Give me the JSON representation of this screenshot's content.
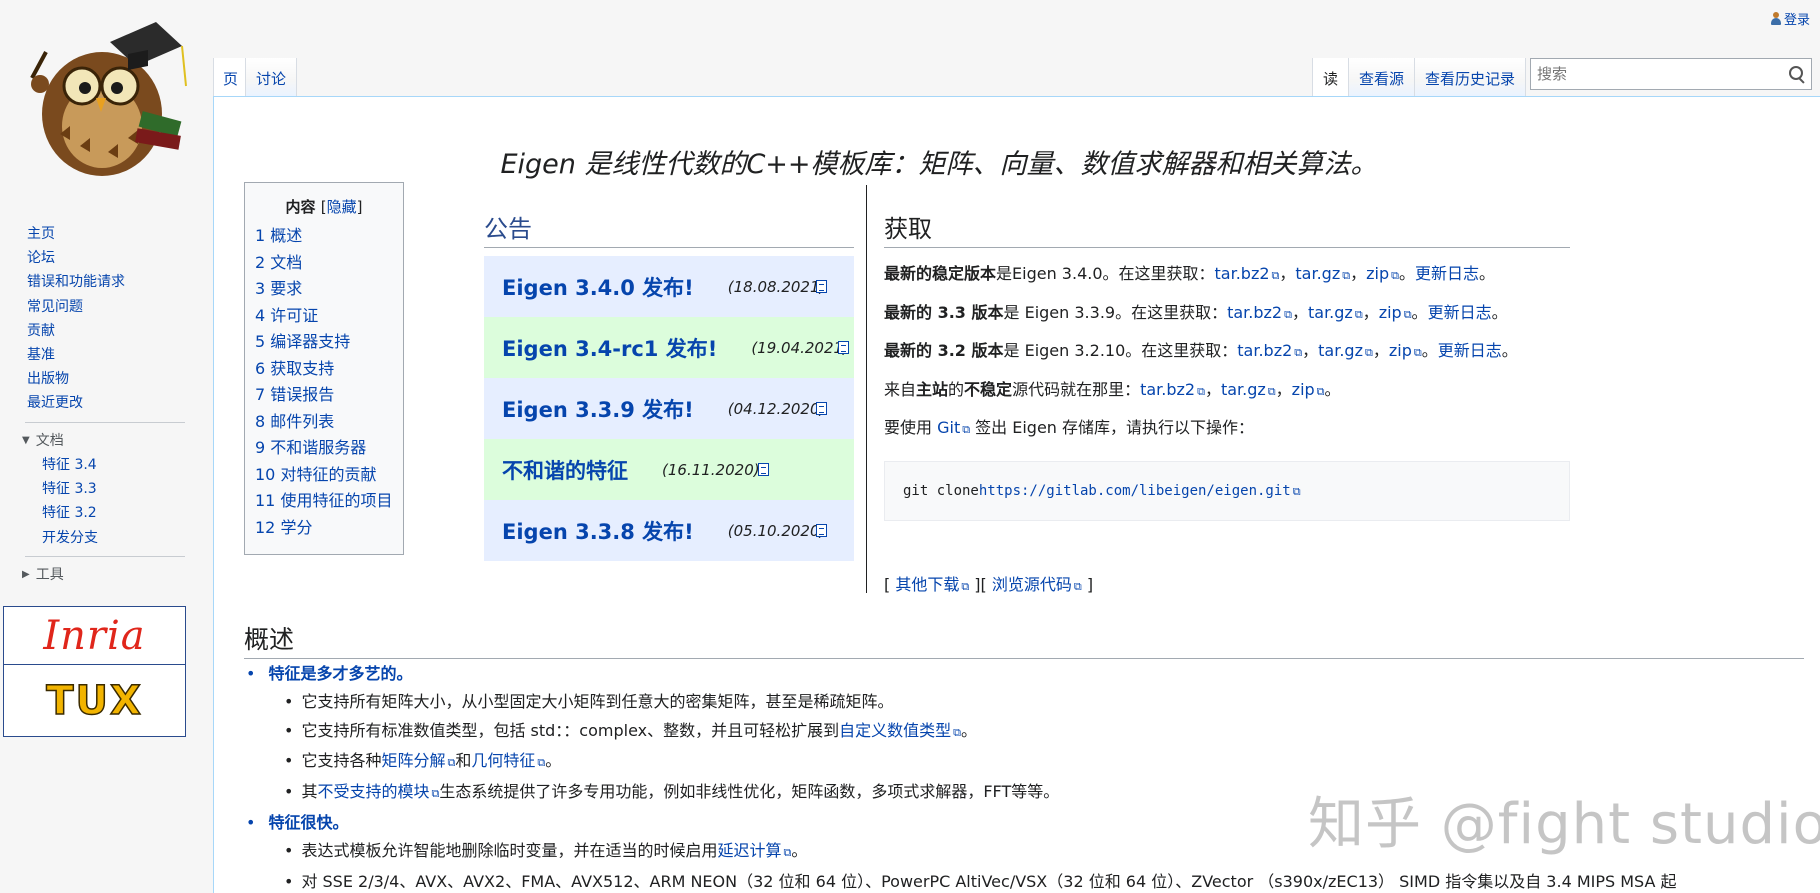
{
  "header": {
    "login": "登录",
    "tabs_left": [
      "页",
      "讨论"
    ],
    "tabs_right": [
      "读",
      "查看源",
      "查看历史记录"
    ],
    "search_placeholder": "搜索"
  },
  "sidebar": {
    "nav": [
      "主页",
      "论坛",
      "错误和功能请求",
      "常见问题",
      "贡献",
      "基准",
      "出版物",
      "最近更改"
    ],
    "docs_heading": "文档",
    "docs_items": [
      "特征 3.4",
      "特征 3.3",
      "特征 3.2",
      "开发分支"
    ],
    "tools_heading": "工具",
    "partner_inria": "Inria",
    "partner_tux": "TUX"
  },
  "tagline": "Eigen 是线性代数的C++模板库：矩阵、向量、数值求解器和相关算法。",
  "toc": {
    "title": "内容",
    "hide_open": "[",
    "hide": "隐藏",
    "hide_close": "]",
    "items": [
      "1 概述",
      "2 文档",
      "3 要求",
      "4 许可证",
      "5 编译器支持",
      "6 获取支持",
      "7 错误报告",
      "8 邮件列表",
      "9 不和谐服务器",
      "10 对特征的贡献",
      "11 使用特征的项目",
      "12 学分"
    ]
  },
  "news": {
    "heading": "公告",
    "items": [
      {
        "title": "Eigen 3.4.0 发布!",
        "date": "(18.08.2021)"
      },
      {
        "title": "Eigen 3.4-rc1 发布!",
        "date": "(19.04.2021)"
      },
      {
        "title": "Eigen 3.3.9 发布!",
        "date": "(04.12.2020)"
      },
      {
        "title": "不和谐的特征",
        "date": "(16.11.2020)"
      },
      {
        "title": "Eigen 3.3.8 发布!",
        "date": "(05.10.2020)"
      }
    ]
  },
  "get": {
    "heading": "获取",
    "line1_bold": "最新的稳定版本",
    "line1_text": "是Eigen 3.4.0。在这里获取：",
    "line2_bold": "最新的 3.3 版本",
    "line2_text": "是 Eigen 3.3.9。在这里获取：",
    "line3_bold": "最新的 3.2 版本",
    "line3_text": "是 Eigen 3.2.10。在这里获取：",
    "line4_a": "来自",
    "line4_b": "主站",
    "line4_c": "的",
    "line4_d": "不稳定",
    "line4_e": "源代码就在那里：",
    "line5_a": "要使用 ",
    "line5_git": "Git",
    "line5_b": " 签出 Eigen 存储库，请执行以下操作：",
    "tarbz2": "tar.bz2",
    "targz": "tar.gz",
    "zip": "zip",
    "comma": "，",
    "changelog": "更新日志",
    "period": "。",
    "code_cmd": "git clone ",
    "code_url": "https://gitlab.com/libeigen/eigen.git",
    "other_downloads": "其他下载",
    "browse_source": "浏览源代码",
    "bracket_open": "[ ",
    "bracket_mid": " ][ ",
    "bracket_close": " ]"
  },
  "overview": {
    "heading": "概述",
    "point1": "特征是多才多艺的。",
    "p1_items": [
      "它支持所有矩阵大小，从小型固定大小矩阵到任意大的密集矩阵，甚至是稀疏矩阵。"
    ],
    "p1_b_a": "它支持所有标准数值类型，包括 std：：complex、整数，并且可轻松扩展到",
    "p1_b_link": "自定义数值类型",
    "p1_b_end": "。",
    "p1_c_a": "它支持各种",
    "p1_c_link1": "矩阵分解",
    "p1_c_mid": "和",
    "p1_c_link2": "几何特征",
    "p1_c_end": "。",
    "p1_d_a": "其",
    "p1_d_link": "不受支持的模块",
    "p1_d_b": "生态系统提供了许多专用功能，例如非线性优化，矩阵函数，多项式求解器，FFT等等。",
    "point2": "特征很快。",
    "p2_a_a": "表达式模板允许智能地删除临时变量，并在适当的时候启用",
    "p2_a_link": "延迟计算",
    "p2_a_end": "。",
    "p2_b": "对 SSE 2/3/4、AVX、AVX2、FMA、AVX512、ARM NEON（32 位和 64 位）、PowerPC AltiVec/VSX（32 位和 64 位）、ZVector （s390x/zEC13） SIMD 指令集以及自 3.4 MIPS MSA 起"
  },
  "watermark": "知乎 @fight studio"
}
